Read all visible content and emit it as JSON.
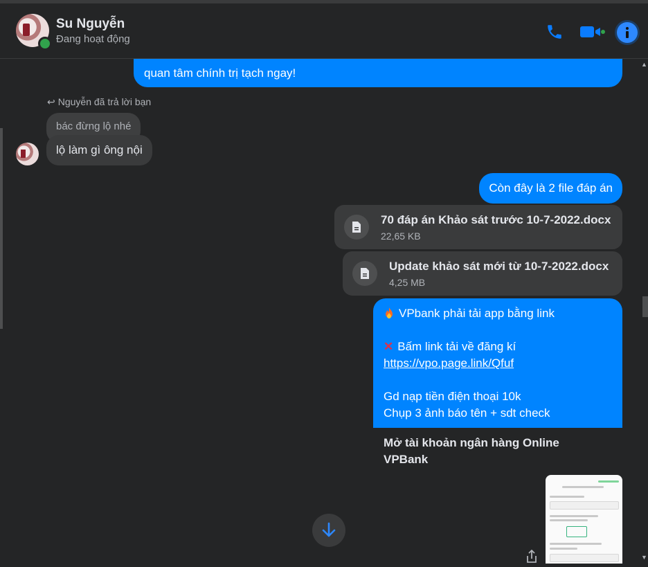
{
  "header": {
    "contact_name": "Su Nguyễn",
    "status": "Đang hoạt động",
    "icons": [
      "phone-icon",
      "video-camera-icon",
      "info-icon"
    ],
    "accent_color": "#0084ff",
    "online_color": "#31a24c"
  },
  "messages": {
    "sent_top": "quan tâm chính trị tạch ngay!",
    "reply_note": "Nguyễn đã trả lời bạn",
    "quoted_text": "bác đừng lộ nhé",
    "received_reply": "lộ làm gì ông nội",
    "sent_files_intro": "Còn đây là 2 file đáp án",
    "files": [
      {
        "name": "70 đáp án Khảo sát trước 10-7-2022.docx",
        "size": "22,65 KB"
      },
      {
        "name": "Update khảo sát mới từ 10-7-2022.docx",
        "size": "4,25 MB"
      }
    ],
    "promo": {
      "line1": "VPbank phải tải app bằng link",
      "line2": "Bấm link tải về đăng kí",
      "link": "https://vpo.page.link/Qfuf",
      "line3": "Gd nạp tiền điện thoại 10k",
      "line4": "Chụp 3 ảnh báo tên + sdt check"
    },
    "link_preview_title": "Mở tài khoản ngân hàng Online VPBank"
  }
}
